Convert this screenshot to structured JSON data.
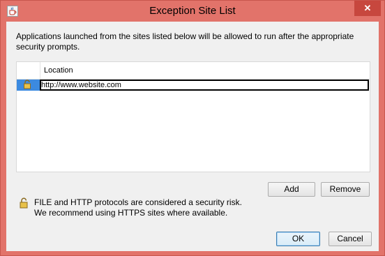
{
  "window": {
    "title": "Exception Site List",
    "close_label": "✕"
  },
  "description": "Applications launched from the sites listed below will be allowed to run after the appropriate security prompts.",
  "table": {
    "column_header": "Location",
    "rows": [
      {
        "location": "http://www.website.com",
        "icon": "unlocked-padlock-icon"
      }
    ]
  },
  "buttons": {
    "add": "Add",
    "remove": "Remove",
    "ok": "OK",
    "cancel": "Cancel"
  },
  "warning": {
    "icon": "unlocked-padlock-icon",
    "line1": "FILE and HTTP protocols are considered a security risk.",
    "line2": "We recommend using HTTPS sites where available."
  },
  "colors": {
    "titlebar": "#e2736a",
    "close_button": "#c7473e",
    "selected_row": "#3c8ae0"
  }
}
